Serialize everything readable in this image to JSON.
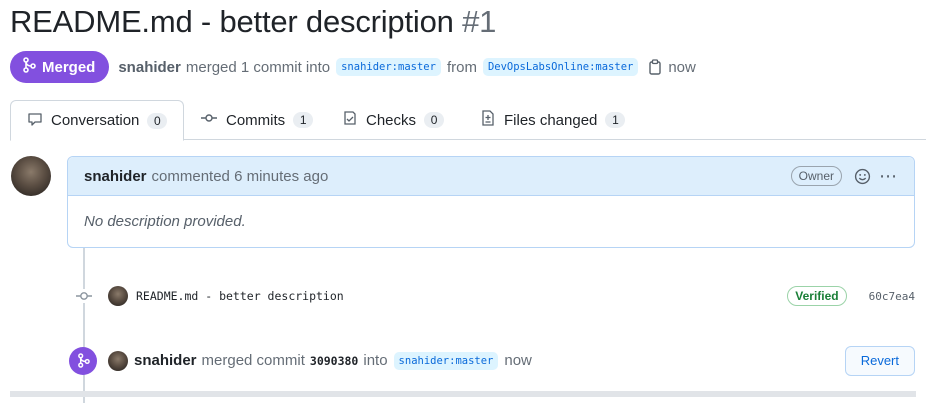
{
  "pr": {
    "title": "README.md - better description",
    "number": "#1",
    "state_label": "Merged",
    "author": "snahider",
    "merge_text": "merged 1 commit into",
    "base_branch": "snahider:master",
    "from_text": "from",
    "head_branch": "DevOpsLabsOnline:master",
    "time": "now"
  },
  "tabs": [
    {
      "label": "Conversation",
      "count": "0",
      "icon": "comment-icon"
    },
    {
      "label": "Commits",
      "count": "1",
      "icon": "commit-icon"
    },
    {
      "label": "Checks",
      "count": "0",
      "icon": "checklist-icon"
    },
    {
      "label": "Files changed",
      "count": "1",
      "icon": "file-diff-icon"
    }
  ],
  "comment": {
    "author": "snahider",
    "action": "commented 6 minutes ago",
    "role_badge": "Owner",
    "body": "No description provided."
  },
  "commit": {
    "message": "README.md - better description",
    "verified_label": "Verified",
    "sha": "60c7ea4"
  },
  "merge_event": {
    "author": "snahider",
    "text": "merged commit",
    "sha": "3090380",
    "into_text": "into",
    "branch": "snahider:master",
    "time": "now",
    "revert_label": "Revert"
  },
  "colors": {
    "merged_purple": "#8250df",
    "link_blue": "#0969da",
    "verified_green": "#1a7f37",
    "comment_header_bg": "#ddeefc"
  }
}
